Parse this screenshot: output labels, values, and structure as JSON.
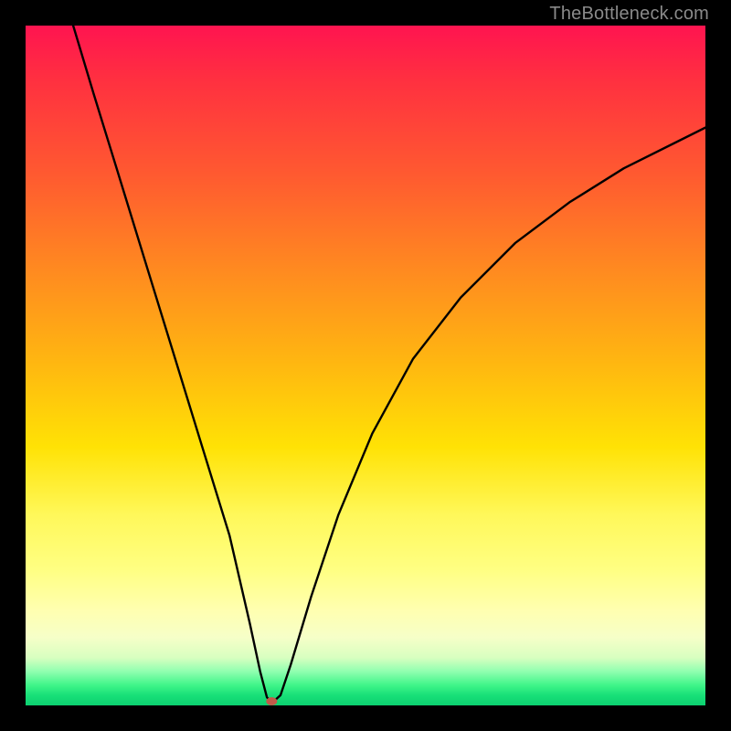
{
  "watermark": "TheBottleneck.com",
  "chart_data": {
    "type": "line",
    "title": "",
    "xlabel": "",
    "ylabel": "",
    "xlim": [
      0,
      100
    ],
    "ylim": [
      0,
      100
    ],
    "series": [
      {
        "name": "curve",
        "x": [
          7,
          10,
          14,
          18,
          22,
          26,
          30,
          33,
          34.5,
          35.5,
          36.0,
          36.5,
          37.5,
          39,
          42,
          46,
          51,
          57,
          64,
          72,
          80,
          88,
          96,
          100
        ],
        "y": [
          100,
          90,
          77,
          64,
          51,
          38,
          25,
          12,
          5,
          1.2,
          0.6,
          0.6,
          1.5,
          6,
          16,
          28,
          40,
          51,
          60,
          68,
          74,
          79,
          83,
          85
        ]
      }
    ],
    "marker": {
      "x": 36.2,
      "y": 0.6,
      "color": "#c25a4a"
    },
    "background_gradient": {
      "top": "#ff1450",
      "mid": "#ffe000",
      "bottom": "#0cd070"
    }
  }
}
